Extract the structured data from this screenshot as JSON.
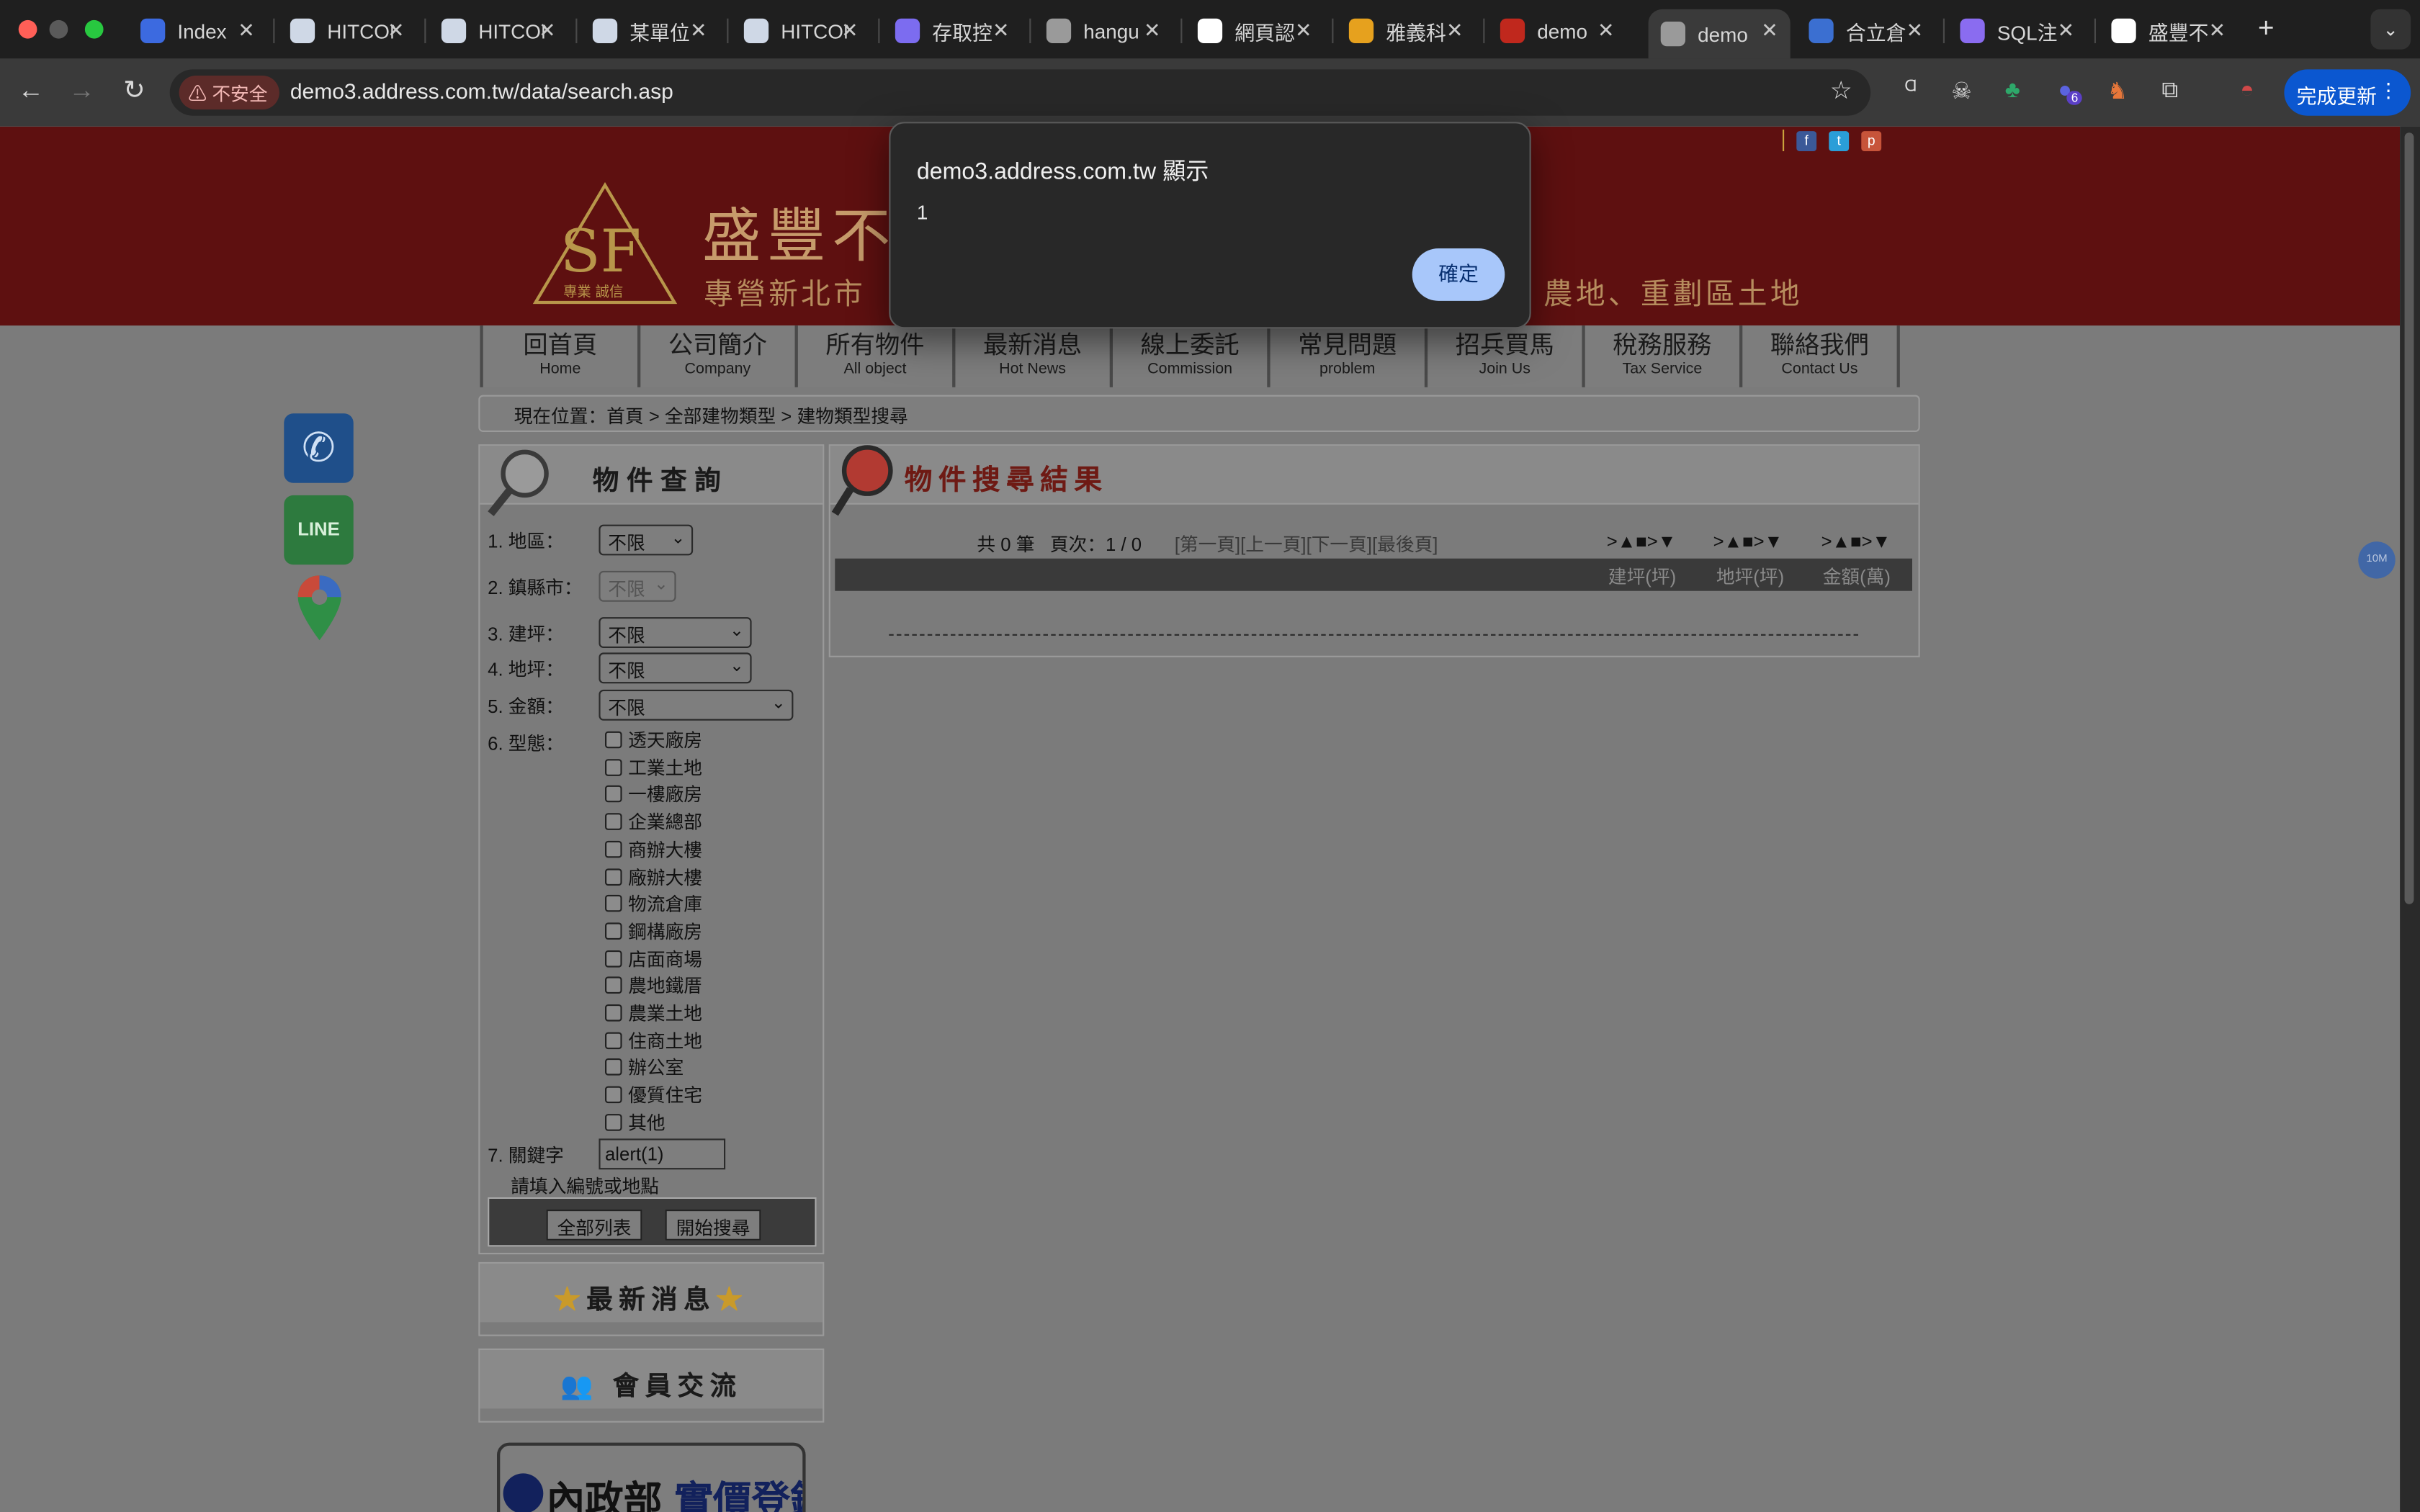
{
  "browser": {
    "tabs": [
      {
        "label": "Index",
        "icon_color": "#3c6ae0"
      },
      {
        "label": "HITCON",
        "icon_color": "#cfd8e6"
      },
      {
        "label": "HITCON",
        "icon_color": "#cfd8e6"
      },
      {
        "label": "某單位",
        "icon_color": "#cfd8e6"
      },
      {
        "label": "HITCON",
        "icon_color": "#cfd8e6"
      },
      {
        "label": "存取控",
        "icon_color": "#7c6cf0"
      },
      {
        "label": "hangu",
        "icon_color": "#9a9a9a"
      },
      {
        "label": "網頁認",
        "icon_color": "#ffffff"
      },
      {
        "label": "雅義科",
        "icon_color": "#e6a11e"
      },
      {
        "label": "demo",
        "icon_color": "#c0281d"
      },
      {
        "label": "demo",
        "icon_color": "#9a9a9a"
      },
      {
        "label": "合立倉",
        "icon_color": "#3b6fd1"
      },
      {
        "label": "SQL注",
        "icon_color": "#8a6cf0"
      },
      {
        "label": "盛豐不",
        "icon_color": "#ffffff"
      }
    ],
    "active_tab": 10,
    "security_label": "不安全",
    "url": "demo3.address.com.tw/data/search.asp",
    "update_button": "完成更新",
    "extension_badge": "6"
  },
  "site": {
    "brand": "盛豐不",
    "tagline_left": "專營新北市",
    "tagline_right": "農地、重劃區土地",
    "logo_text": "SF",
    "logo_sub": "專業 誠信",
    "nav": [
      {
        "zh": "回首頁",
        "en": "Home"
      },
      {
        "zh": "公司簡介",
        "en": "Company"
      },
      {
        "zh": "所有物件",
        "en": "All object"
      },
      {
        "zh": "最新消息",
        "en": "Hot News"
      },
      {
        "zh": "線上委託",
        "en": "Commission"
      },
      {
        "zh": "常見問題",
        "en": "problem"
      },
      {
        "zh": "招兵買馬",
        "en": "Join Us"
      },
      {
        "zh": "稅務服務",
        "en": "Tax Service"
      },
      {
        "zh": "聯絡我們",
        "en": "Contact Us"
      }
    ],
    "breadcrumb": "現在位置：首頁 > 全部建物類型 > 建物類型搜尋"
  },
  "search": {
    "title": "物件查詢",
    "region_label": "1. 地區：",
    "region_value": "不限",
    "city_label": "2. 鎮縣市：",
    "city_value": "不限",
    "building_area_label": "3. 建坪：",
    "building_area_value": "不限",
    "land_area_label": "4. 地坪：",
    "land_area_value": "不限",
    "price_label": "5. 金額：",
    "price_value": "不限",
    "type_label": "6. 型態：",
    "types": [
      "透天廠房",
      "工業土地",
      "一樓廠房",
      "企業總部",
      "商辦大樓",
      "廠辦大樓",
      "物流倉庫",
      "鋼構廠房",
      "店面商場",
      "農地鐵厝",
      "農業土地",
      "住商土地",
      "辦公室",
      "優質住宅",
      "其他"
    ],
    "keyword_label": "7. 關鍵字",
    "keyword_value": "alert(1)",
    "keyword_hint": "請填入編號或地點",
    "list_all_button": "全部列表",
    "search_button": "開始搜尋"
  },
  "results": {
    "title": "物件搜尋結果",
    "count": "共 0 筆",
    "page": "頁次：1 / 0",
    "pager": "[第一頁][上一頁][下一頁][最後頁]",
    "sort_symbol": ">▲■>▼",
    "columns": [
      "建坪(坪)",
      "地坪(坪)",
      "金額(萬)"
    ]
  },
  "widgets": {
    "news_title": "最新消息",
    "members_title": "會員交流",
    "moi_text_a": "內政部",
    "moi_text_b": "實價登錄",
    "line_label": "LINE",
    "float_badge": "10M"
  },
  "dialog": {
    "title": "demo3.address.com.tw 顯示",
    "message": "1",
    "ok": "確定"
  },
  "colors": {
    "banner": "#5e1010",
    "dialog_button": "#a8c7fa",
    "update_button": "#0b57d0"
  }
}
